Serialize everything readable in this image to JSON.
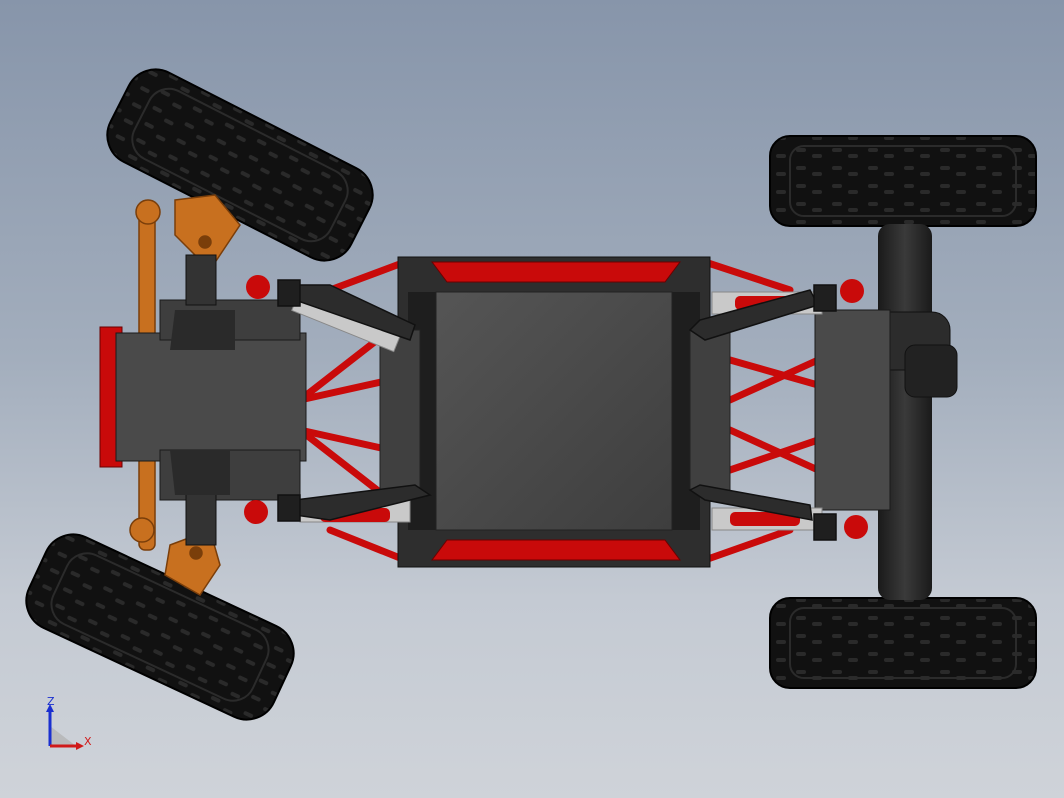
{
  "viewport": {
    "background_top": "#8795aa",
    "background_bottom": "#cfd3d9"
  },
  "model": {
    "tire_color": "#0d0d0d",
    "frame_color": "#c90a0a",
    "steering_color": "#c8701f",
    "body_color": "#4a4a4a",
    "plate_color": "#3a3a3a",
    "spring_color": "#c9c9c9"
  },
  "triad": {
    "z_label": "Z",
    "x_label": "X",
    "z_color": "#1a2fd0",
    "x_color": "#d01a1a"
  }
}
